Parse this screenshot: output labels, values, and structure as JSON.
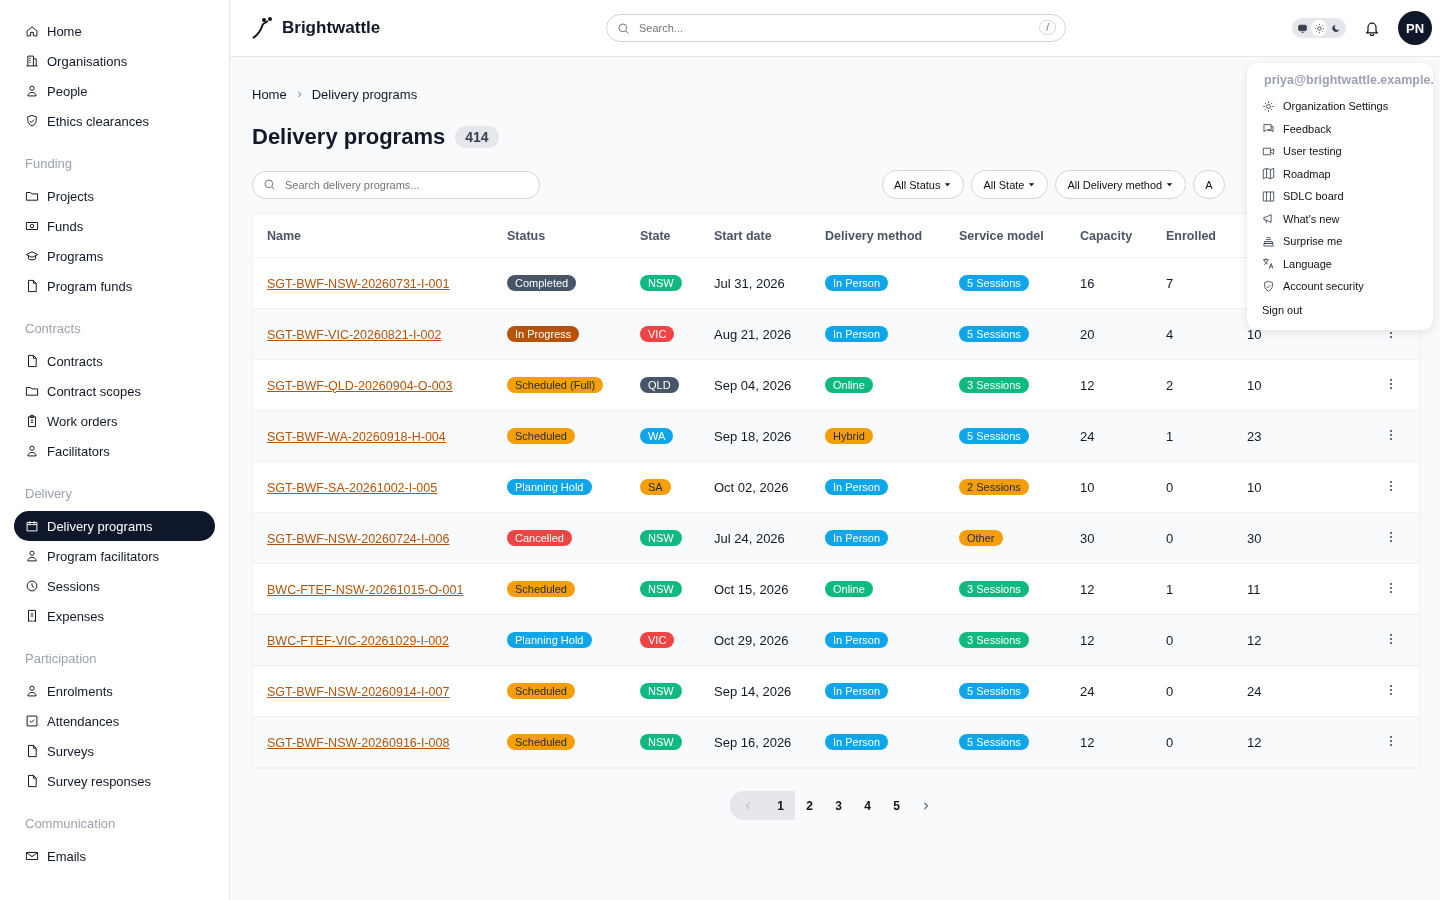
{
  "sidebar": {
    "sections": [
      {
        "items": [
          {
            "label": "Home",
            "selected": false
          },
          {
            "label": "Organisations",
            "selected": false
          },
          {
            "label": "People",
            "selected": false
          },
          {
            "label": "Ethics clearances",
            "selected": false
          }
        ]
      },
      {
        "title": "Funding",
        "items": [
          {
            "label": "Projects",
            "selected": false
          },
          {
            "label": "Funds",
            "selected": false
          },
          {
            "label": "Programs",
            "selected": false
          },
          {
            "label": "Program funds",
            "selected": false
          }
        ]
      },
      {
        "title": "Contracts",
        "items": [
          {
            "label": "Contracts",
            "selected": false
          },
          {
            "label": "Contract scopes",
            "selected": false
          },
          {
            "label": "Work orders",
            "selected": false
          },
          {
            "label": "Facilitators",
            "selected": false
          }
        ]
      },
      {
        "title": "Delivery",
        "items": [
          {
            "label": "Delivery programs",
            "selected": true
          },
          {
            "label": "Program facilitators",
            "selected": false
          },
          {
            "label": "Sessions",
            "selected": false
          },
          {
            "label": "Expenses",
            "selected": false
          }
        ]
      },
      {
        "title": "Participation",
        "items": [
          {
            "label": "Enrolments",
            "selected": false
          },
          {
            "label": "Attendances",
            "selected": false
          },
          {
            "label": "Surveys",
            "selected": false
          },
          {
            "label": "Survey responses",
            "selected": false
          }
        ]
      },
      {
        "title": "Communication",
        "items": [
          {
            "label": "Emails",
            "selected": false
          }
        ]
      }
    ]
  },
  "header": {
    "brand": "Brightwattle",
    "search": {
      "placeholder": "Search...",
      "shortcut": "/"
    },
    "theme_options": [
      {
        "kind": "system",
        "selected": false
      },
      {
        "kind": "light",
        "selected": true
      },
      {
        "kind": "dark",
        "selected": false
      }
    ],
    "avatar": "PN"
  },
  "breadcrumb": [
    "Home",
    "Delivery programs"
  ],
  "page": {
    "title": "Delivery programs",
    "count": "414"
  },
  "search": {
    "placeholder": "Search delivery programs..."
  },
  "filters": [
    "All Status",
    "All State",
    "All Delivery method",
    "A"
  ],
  "table": {
    "columns": [
      "Name",
      "Status",
      "State",
      "Start date",
      "Delivery method",
      "Service model",
      "Capacity",
      "Enrolled"
    ],
    "rows": [
      {
        "name": "SGT-BWF-NSW-20260731-I-001",
        "status": {
          "text": "Completed",
          "color": "#475569"
        },
        "state": {
          "text": "NSW",
          "color": "#10b981"
        },
        "start": "Jul 31, 2026",
        "method": {
          "text": "In Person",
          "color": "#0ea5e9"
        },
        "service": {
          "text": "5 Sessions",
          "color": "#0ea5e9"
        },
        "capacity": "16",
        "enrolled": "7"
      },
      {
        "name": "SGT-BWF-VIC-20260821-I-002",
        "status": {
          "text": "In Progress",
          "color": "#b45309"
        },
        "state": {
          "text": "VIC",
          "color": "#ef4444"
        },
        "start": "Aug 21, 2026",
        "method": {
          "text": "In Person",
          "color": "#0ea5e9"
        },
        "service": {
          "text": "5 Sessions",
          "color": "#0ea5e9"
        },
        "capacity": "20",
        "enrolled": "4",
        "column_9": "10",
        "menu": true
      },
      {
        "name": "SGT-BWF-QLD-20260904-O-003",
        "status": {
          "text": "Scheduled (Full)",
          "color": "#f59e0b"
        },
        "state": {
          "text": "QLD",
          "color": "#475569"
        },
        "start": "Sep 04, 2026",
        "method": {
          "text": "Online",
          "color": "#10b981"
        },
        "service": {
          "text": "3 Sessions",
          "color": "#10b981"
        },
        "capacity": "12",
        "enrolled": "2",
        "column_9": "10",
        "menu": true
      },
      {
        "name": "SGT-BWF-WA-20260918-H-004",
        "status": {
          "text": "Scheduled",
          "color": "#f59e0b"
        },
        "state": {
          "text": "WA",
          "color": "#0ea5e9"
        },
        "start": "Sep 18, 2026",
        "method": {
          "text": "Hybrid",
          "color": "#f59e0b"
        },
        "service": {
          "text": "5 Sessions",
          "color": "#0ea5e9"
        },
        "capacity": "24",
        "enrolled": "1",
        "column_9": "23",
        "menu": true
      },
      {
        "name": "SGT-BWF-SA-20261002-I-005",
        "status": {
          "text": "Planning Hold",
          "color": "#0ea5e9"
        },
        "state": {
          "text": "SA",
          "color": "#f59e0b"
        },
        "start": "Oct 02, 2026",
        "method": {
          "text": "In Person",
          "color": "#0ea5e9"
        },
        "service": {
          "text": "2 Sessions",
          "color": "#f59e0b"
        },
        "capacity": "10",
        "enrolled": "0",
        "column_9": "10",
        "menu": true
      },
      {
        "name": "SGT-BWF-NSW-20260724-I-006",
        "status": {
          "text": "Cancelled",
          "color": "#ef4444"
        },
        "state": {
          "text": "NSW",
          "color": "#10b981"
        },
        "start": "Jul 24, 2026",
        "method": {
          "text": "In Person",
          "color": "#0ea5e9"
        },
        "service": {
          "text": "Other",
          "color": "#f59e0b"
        },
        "capacity": "30",
        "enrolled": "0",
        "column_9": "30",
        "menu": true
      },
      {
        "name": "BWC-FTEF-NSW-20261015-O-001",
        "status": {
          "text": "Scheduled",
          "color": "#f59e0b"
        },
        "state": {
          "text": "NSW",
          "color": "#10b981"
        },
        "start": "Oct 15, 2026",
        "method": {
          "text": "Online",
          "color": "#10b981"
        },
        "service": {
          "text": "3 Sessions",
          "color": "#10b981"
        },
        "capacity": "12",
        "enrolled": "1",
        "column_9": "11",
        "menu": true
      },
      {
        "name": "BWC-FTEF-VIC-20261029-I-002",
        "status": {
          "text": "Planning Hold",
          "color": "#0ea5e9"
        },
        "state": {
          "text": "VIC",
          "color": "#ef4444"
        },
        "start": "Oct 29, 2026",
        "method": {
          "text": "In Person",
          "color": "#0ea5e9"
        },
        "service": {
          "text": "3 Sessions",
          "color": "#10b981"
        },
        "capacity": "12",
        "enrolled": "0",
        "column_9": "12",
        "menu": true
      },
      {
        "name": "SGT-BWF-NSW-20260914-I-007",
        "status": {
          "text": "Scheduled",
          "color": "#f59e0b"
        },
        "state": {
          "text": "NSW",
          "color": "#10b981"
        },
        "start": "Sep 14, 2026",
        "method": {
          "text": "In Person",
          "color": "#0ea5e9"
        },
        "service": {
          "text": "5 Sessions",
          "color": "#0ea5e9"
        },
        "capacity": "24",
        "enrolled": "0",
        "column_9": "24",
        "menu": true
      },
      {
        "name": "SGT-BWF-NSW-20260916-I-008",
        "status": {
          "text": "Scheduled",
          "color": "#f59e0b"
        },
        "state": {
          "text": "NSW",
          "color": "#10b981"
        },
        "start": "Sep 16, 2026",
        "method": {
          "text": "In Person",
          "color": "#0ea5e9"
        },
        "service": {
          "text": "5 Sessions",
          "color": "#0ea5e9"
        },
        "capacity": "12",
        "enrolled": "0",
        "column_9": "12",
        "menu": true
      }
    ]
  },
  "pagination": {
    "prev_disabled": true,
    "pages": [
      {
        "label": "1",
        "selected": true
      },
      {
        "label": "2",
        "selected": false
      },
      {
        "label": "3",
        "selected": false
      },
      {
        "label": "4",
        "selected": false
      },
      {
        "label": "5",
        "selected": false
      }
    ]
  },
  "user_menu": {
    "email": "priya@brightwattle.example.",
    "items": [
      "Organization Settings",
      "Feedback",
      "User testing",
      "Roadmap",
      "SDLC board",
      "What's new",
      "Surprise me",
      "Language",
      "Account security"
    ],
    "sign_out": "Sign out"
  }
}
